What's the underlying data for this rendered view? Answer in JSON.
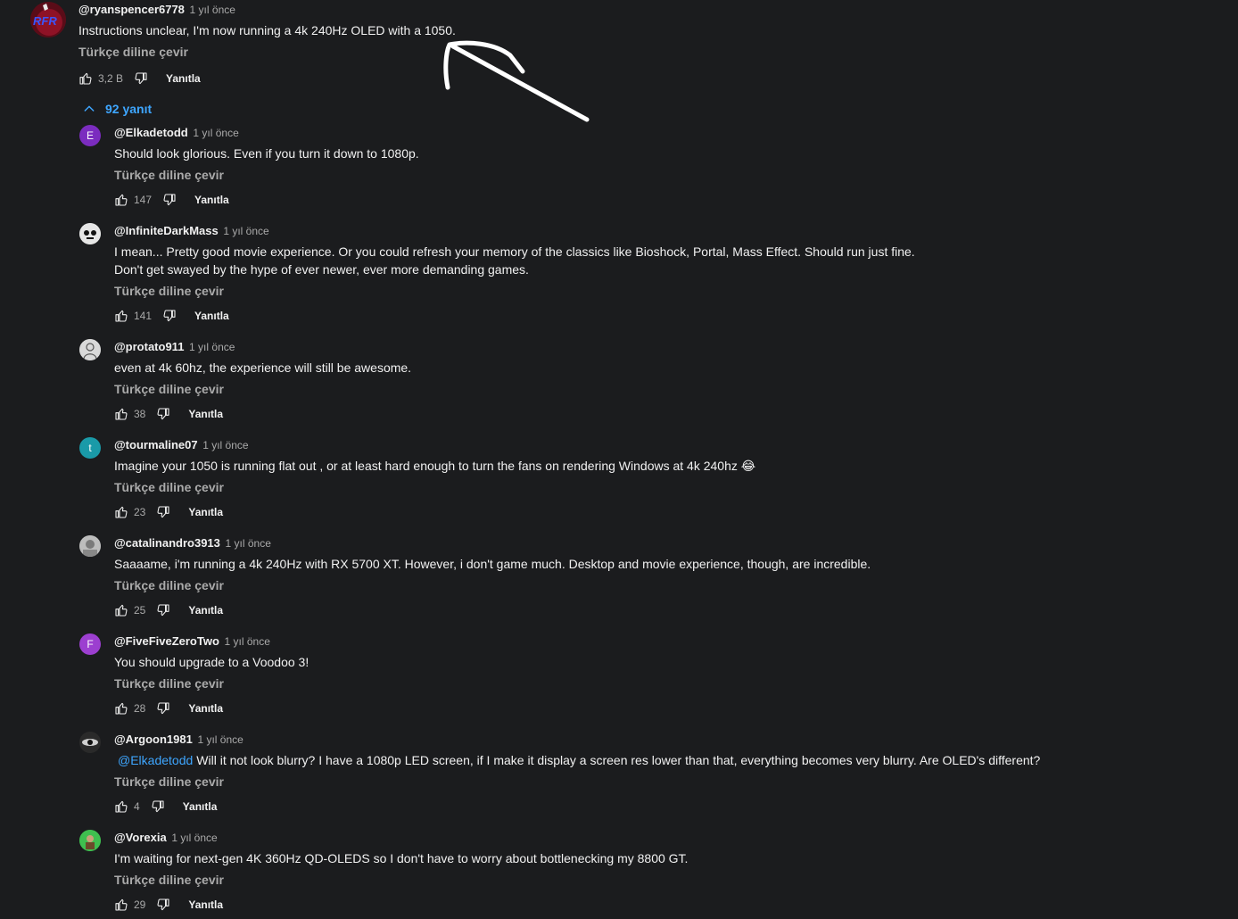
{
  "main_comment": {
    "author": "@ryanspencer6778",
    "time": "1 yıl önce",
    "text": "Instructions unclear, I'm now running a 4k 240Hz OLED with a 1050.",
    "translate": "Türkçe diline çevir",
    "likes": "3,2 B",
    "reply_label": "Yanıtla",
    "avatar_text": "RFR",
    "avatar_icon": "channel-avatar"
  },
  "replies_toggle": {
    "label": "92 yanıt",
    "icon": "chevron-up-icon",
    "color": "#3ea6ff"
  },
  "replies": [
    {
      "author": "@Elkadetodd",
      "time": "1 yıl önce",
      "text": "Should look glorious.  Even if you turn it down to 1080p.",
      "translate": "Türkçe diline çevir",
      "likes": "147",
      "reply_label": "Yanıtla",
      "avatar_letter": "E",
      "avatar_color": "#7b2cbf"
    },
    {
      "author": "@InfiniteDarkMass",
      "time": "1 yıl önce",
      "text": "I mean... Pretty good movie experience. Or you could refresh your memory of the classics like Bioshock, Portal, Mass Effect. Should run just fine.",
      "text2": "Don't get swayed by the hype of ever newer, ever more demanding games.",
      "translate": "Türkçe diline çevir",
      "likes": "141",
      "reply_label": "Yanıtla",
      "avatar_letter": "",
      "avatar_color": "#e6e6e6"
    },
    {
      "author": "@protato911",
      "time": "1 yıl önce",
      "text": "even at 4k 60hz, the experience will still be awesome.",
      "translate": "Türkçe diline çevir",
      "likes": "38",
      "reply_label": "Yanıtla",
      "avatar_letter": "",
      "avatar_color": "#d9d9d9"
    },
    {
      "author": "@tourmaline07",
      "time": "1 yıl önce",
      "text": "Imagine your 1050 is running flat out , or at least hard enough to turn the fans on rendering Windows at 4k 240hz 😂",
      "translate": "Türkçe diline çevir",
      "likes": "23",
      "reply_label": "Yanıtla",
      "avatar_letter": "t",
      "avatar_color": "#1a9aa8"
    },
    {
      "author": "@catalinandro3913",
      "time": "1 yıl önce",
      "text": "Saaaame, i'm running a 4k 240Hz with RX 5700 XT. However, i don't game much. Desktop and movie experience, though, are incredible.",
      "translate": "Türkçe diline çevir",
      "likes": "25",
      "reply_label": "Yanıtla",
      "avatar_letter": "",
      "avatar_color": "#bdbdbd"
    },
    {
      "author": "@FiveFiveZeroTwo",
      "time": "1 yıl önce",
      "text": "You should upgrade to a Voodoo 3!",
      "translate": "Türkçe diline çevir",
      "likes": "28",
      "reply_label": "Yanıtla",
      "avatar_letter": "F",
      "avatar_color": "#9c3fd0"
    },
    {
      "author": "@Argoon1981",
      "time": "1 yıl önce",
      "mention": "@Elkadetodd",
      "text": "Will it not look blurry? I have a 1080p LED screen, if I make it display a screen res lower than that, everything becomes very blurry.  Are OLED's different?",
      "translate": "Türkçe diline çevir",
      "likes": "4",
      "reply_label": "Yanıtla",
      "avatar_letter": "",
      "avatar_color": "#2a2a2a"
    },
    {
      "author": "@Vorexia",
      "time": "1 yıl önce",
      "text": "I'm waiting for next-gen 4K 360Hz QD-OLEDS so I don't have to worry about bottlenecking my 8800 GT.",
      "translate": "Türkçe diline çevir",
      "likes": "29",
      "reply_label": "Yanıtla",
      "avatar_letter": "",
      "avatar_color": "#3fbf4f"
    }
  ],
  "icons": {
    "like": "thumbs-up-icon",
    "dislike": "thumbs-down-icon"
  },
  "colors": {
    "background": "#1b1c1e",
    "link": "#3ea6ff",
    "muted": "#aaaaaa"
  }
}
